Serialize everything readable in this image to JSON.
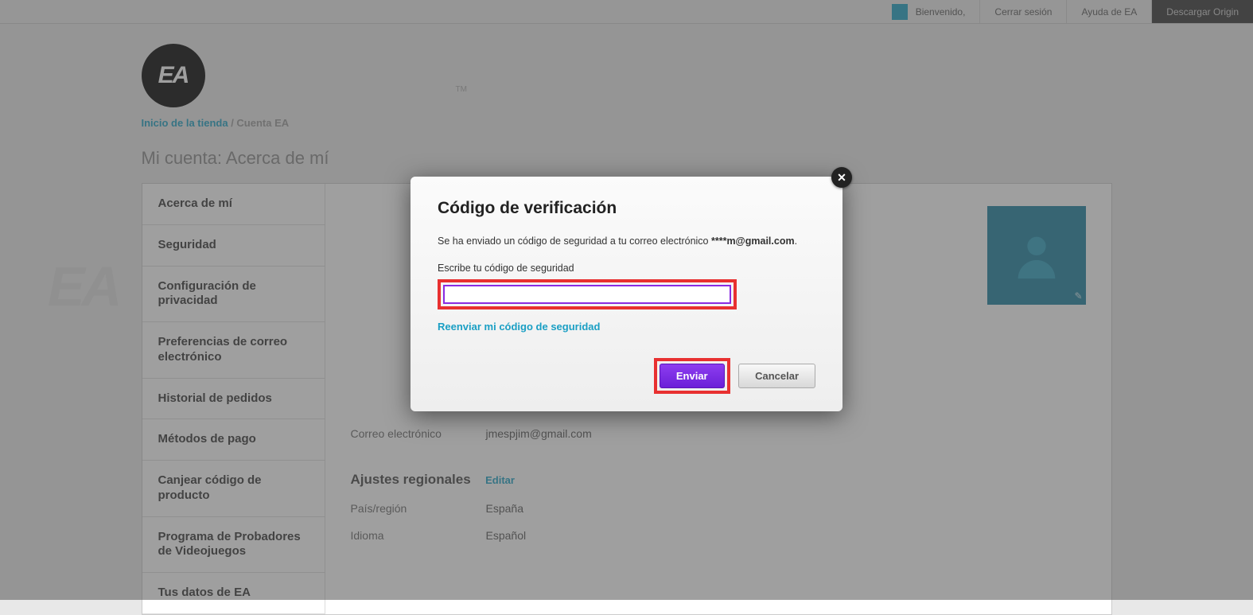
{
  "topbar": {
    "welcome": "Bienvenido,",
    "logout": "Cerrar sesión",
    "help": "Ayuda de EA",
    "download": "Descargar Origin"
  },
  "logo": "EA",
  "tm": "TM",
  "breadcrumb": {
    "a": "Inicio de la tienda",
    "sep": " / ",
    "b": "Cuenta EA"
  },
  "page_title": "Mi cuenta: Acerca de mí",
  "side": [
    "Acerca de mí",
    "Seguridad",
    "Configuración de privacidad",
    "Preferencias de correo electrónico",
    "Historial de pedidos",
    "Métodos de pago",
    "Canjear código de producto",
    "Programa de Probadores de Videojuegos",
    "Tus datos de EA"
  ],
  "main": {
    "email_label": "Correo electrónico",
    "email_value": "jmespjim@gmail.com",
    "regional_title": "Ajustes regionales",
    "edit": "Editar",
    "country_label": "País/región",
    "country_value": "España",
    "lang_label": "Idioma",
    "lang_value": "Español"
  },
  "modal": {
    "title": "Código de verificación",
    "msg_a": "Se ha enviado un código de seguridad a tu correo electrónico  ",
    "msg_b": "****m@gmail.com",
    "input_label": "Escribe tu código de seguridad",
    "resend": "Reenviar mi código de seguridad",
    "send": "Enviar",
    "cancel": "Cancelar"
  },
  "watermark": "EA"
}
